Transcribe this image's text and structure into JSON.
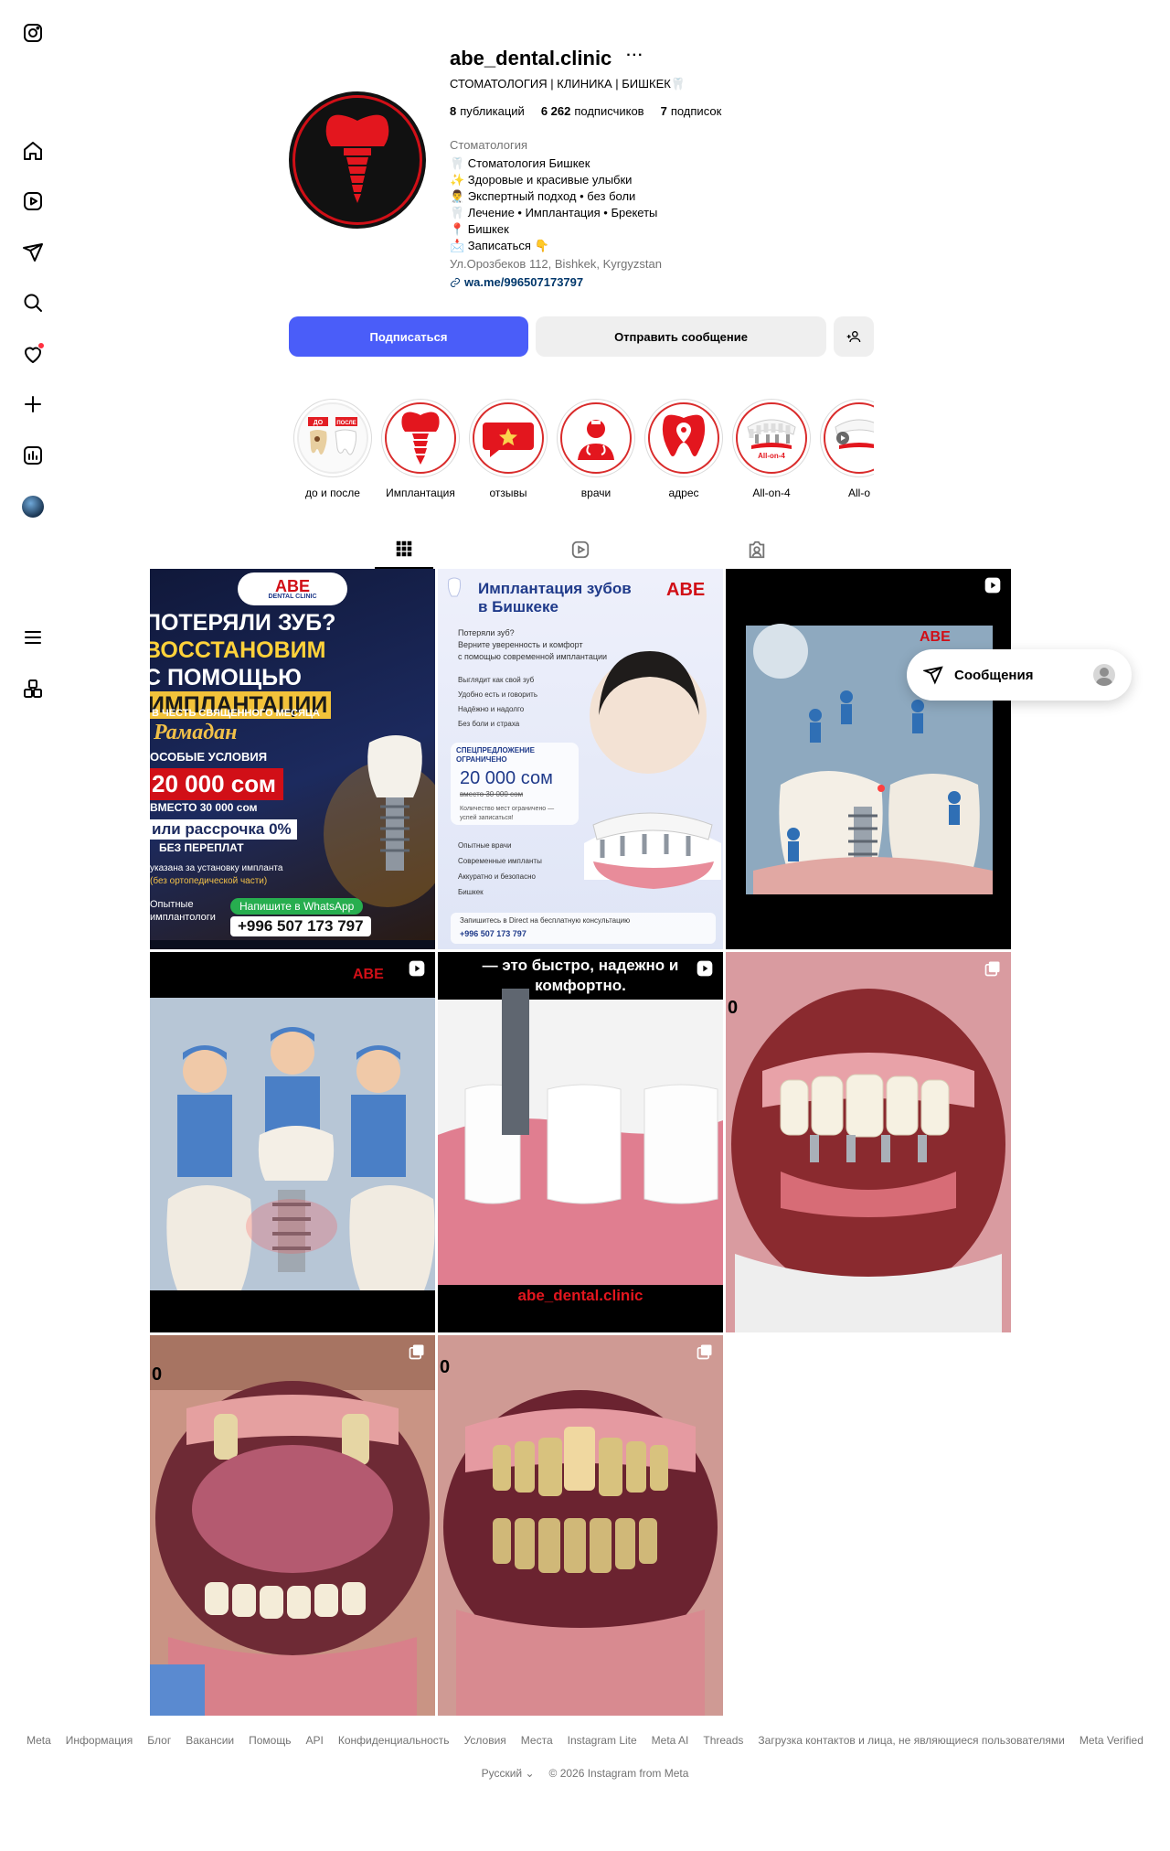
{
  "nav": {
    "logo": "instagram-logo",
    "items": [
      "home",
      "reels",
      "direct",
      "search",
      "notifications",
      "create",
      "dashboard",
      "profile"
    ],
    "more": "menu",
    "also_from_meta": "apps"
  },
  "profile": {
    "username": "abe_dental.clinic",
    "fullname": "СТОМАТОЛОГИЯ | КЛИНИКА | БИШКЕК🦷",
    "stats": {
      "posts_count": "8",
      "posts_label": "публикаций",
      "followers_count": "6 262",
      "followers_label": "подписчиков",
      "following_count": "7",
      "following_label": "подписок"
    },
    "category": "Стоматология",
    "bio": [
      "🦷 Стоматология Бишкек",
      "✨ Здоровые и красивые улыбки",
      "👨‍⚕️ Экспертный подход • без боли",
      "🦷 Лечение • Имплантация • Брекеты",
      "📍 Бишкек",
      "📩 Записаться 👇"
    ],
    "address": "Ул.Орозбеков 112, Bishkek, Kyrgyzstan",
    "link": "wa.me/996507173797"
  },
  "actions": {
    "follow": "Подписаться",
    "message": "Отправить сообщение"
  },
  "highlights": [
    {
      "label": "до и после",
      "tag_before": "ДО",
      "tag_after": "ПОСЛЕ"
    },
    {
      "label": "Имплантация"
    },
    {
      "label": "отзывы"
    },
    {
      "label": "врачи"
    },
    {
      "label": "адрес"
    },
    {
      "label": "All-on-4",
      "tag": "All-on-4"
    },
    {
      "label": "All-o"
    }
  ],
  "posts": {
    "p1": {
      "brand": "ABE",
      "brand_sub": "DENTAL CLINIC",
      "line1": "ПОТЕРЯЛИ ЗУБ?",
      "line2": "ВОССТАНОВИМ",
      "line3": "С ПОМОЩЬЮ",
      "line4": "ИМПЛАНТАЦИИ",
      "line5": "В ЧЕСТЬ СВЯЩЕННОГО МЕСЯЦА",
      "ramadan": "Рамадан",
      "cond": "ОСОБЫЕ УСЛОВИЯ",
      "price": "20 000 сом",
      "old_price": "ВМЕСТО 30 000 сом",
      "installment": "или рассрочка 0%",
      "no_overpay": "БЕЗ ПЕРЕПЛАТ",
      "note1": "указана за установку импланта",
      "note2": "(без ортопедической части)",
      "exp1": "Опытные",
      "exp2": "имплантологи",
      "wa": "Напишите в WhatsApp",
      "phone": "+996 507 173 797"
    },
    "p2": {
      "title1": "Имплантация зубов",
      "title2": "в Бишкеке",
      "brand": "ABE",
      "q": "Потеряли зуб?",
      "t1": "Верните уверенность и комфорт",
      "t2": "с помощью современной имплантации",
      "b1": "Выглядит как свой зуб",
      "b2": "Удобно есть и говорить",
      "b3": "Надёжно и надолго",
      "b4": "Без боли и страха",
      "offer1": "СПЕЦПРЕДЛОЖЕНИЕ",
      "offer2": "ОГРАНИЧЕНО",
      "price": "20 000 сом",
      "old": "вместо 30 000 сом",
      "limited": "Количество мест ограничено —",
      "limited2": "успей записаться!",
      "f1": "Опытные врачи",
      "f2": "Современные импланты",
      "f3": "Аккуратно и безопасно",
      "f4": "Бишкек",
      "cta": "Запишитесь в Direct на бесплатную консультацию",
      "phone": "+996 507 173 797"
    },
    "p3": {
      "brand": "ABE"
    },
    "p4": {
      "brand": "ABE"
    },
    "p5": {
      "caption1": "— это быстро, надежно и",
      "caption2": "комфортно.",
      "handle": "abe_dental.clinic"
    },
    "p6": {
      "mark": "0"
    },
    "p7": {
      "mark": "0"
    },
    "p8": {
      "mark": "0"
    }
  },
  "messages": {
    "label": "Сообщения"
  },
  "footer": {
    "links": [
      "Meta",
      "Информация",
      "Блог",
      "Вакансии",
      "Помощь",
      "API",
      "Конфиденциальность",
      "Условия",
      "Места",
      "Instagram Lite",
      "Meta AI",
      "Threads",
      "Загрузка контактов и лица, не являющиеся пользователями",
      "Meta Verified"
    ],
    "language": "Русский",
    "copyright": "© 2026 Instagram from Meta"
  },
  "colors": {
    "follow_button": "#4a5df9",
    "brand_red": "#d10f17",
    "link": "#00376b",
    "muted": "#737373"
  }
}
